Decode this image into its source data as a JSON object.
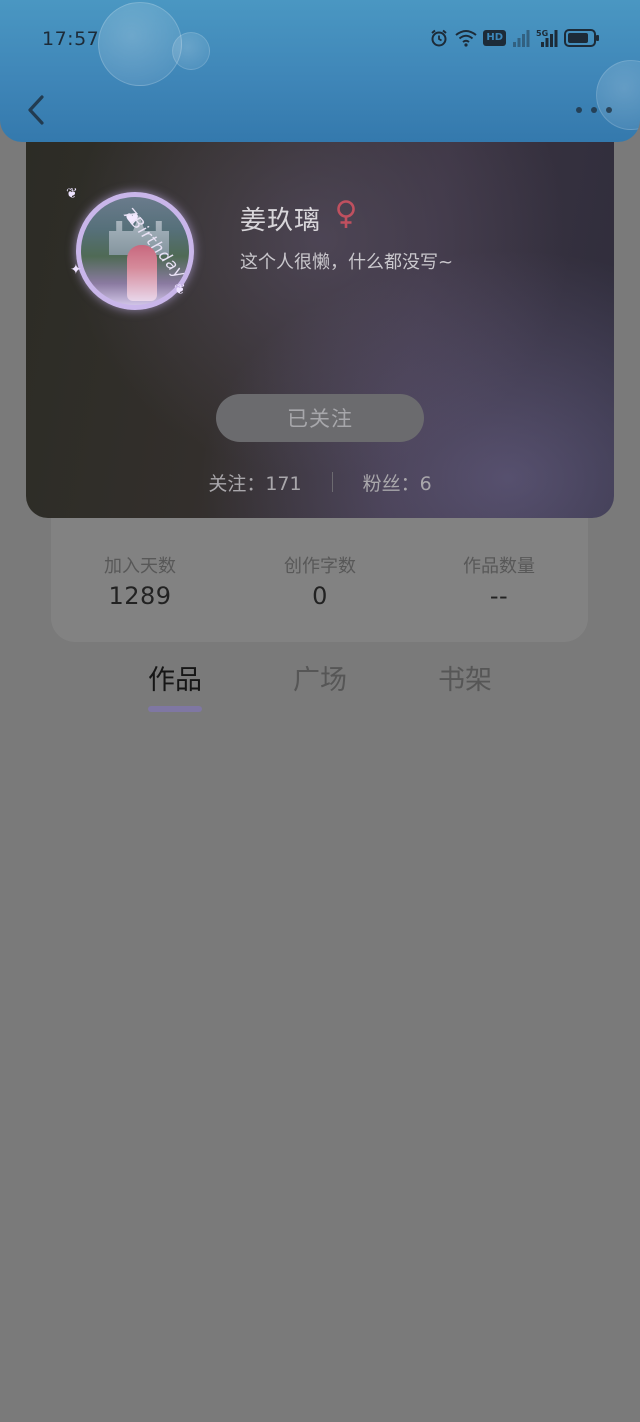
{
  "status_bar": {
    "time": "17:57",
    "icons": [
      "alarm-icon",
      "wifi-icon",
      "hd-icon",
      "signal-icon",
      "5g-signal-icon",
      "battery-icon"
    ],
    "hd_label": "HD"
  },
  "header": {
    "back_icon": "chevron-left-icon",
    "more_icon": "more-horizontal-icon"
  },
  "profile": {
    "name": "姜玖璃",
    "gender_icon": "female-icon",
    "gender_color": "#c0505f",
    "bio": "这个人很懒，什么都没写~",
    "avatar_text": "7Birthday",
    "follow_button_label": "已关注",
    "following_label": "关注：171",
    "followers_label": "粉丝：6"
  },
  "stats": [
    {
      "label": "加入天数",
      "value": "1289"
    },
    {
      "label": "创作字数",
      "value": "0"
    },
    {
      "label": "作品数量",
      "value": "--"
    }
  ],
  "tabs": [
    {
      "label": "作品",
      "active": true
    },
    {
      "label": "广场",
      "active": false
    },
    {
      "label": "书架",
      "active": false
    }
  ],
  "colors": {
    "header_blue": "#3f86b8",
    "accent_purple": "#7f77a3",
    "overlay_gray": "#7a7a7a"
  }
}
